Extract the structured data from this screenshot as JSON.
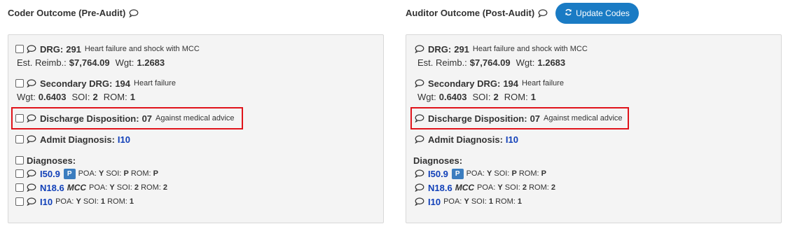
{
  "coder": {
    "title": "Coder Outcome (Pre-Audit)",
    "drg": {
      "label": "DRG:",
      "code": "291",
      "desc": "Heart failure and shock with MCC"
    },
    "reimb": {
      "label": "Est. Reimb.:",
      "value": "$7,764.09",
      "wgt_label": "Wgt:",
      "wgt": "1.2683"
    },
    "secondary": {
      "label": "Secondary DRG:",
      "code": "194",
      "desc": "Heart failure"
    },
    "sec_stats": {
      "wgt_label": "Wgt:",
      "wgt": "0.6403",
      "soi_label": "SOI:",
      "soi": "2",
      "rom_label": "ROM:",
      "rom": "1"
    },
    "discharge": {
      "label": "Discharge Disposition:",
      "code": "07",
      "desc": "Against medical advice"
    },
    "admit": {
      "label": "Admit Diagnosis:",
      "code": "I10"
    },
    "diagnoses_label": "Diagnoses:",
    "diagnoses": [
      {
        "code": "I50.9",
        "badge": "P",
        "mcc": "",
        "poa": "Y",
        "soi": "P",
        "rom": "P"
      },
      {
        "code": "N18.6",
        "badge": "",
        "mcc": "MCC",
        "poa": "Y",
        "soi": "2",
        "rom": "2"
      },
      {
        "code": "I10",
        "badge": "",
        "mcc": "",
        "poa": "Y",
        "soi": "1",
        "rom": "1"
      }
    ]
  },
  "auditor": {
    "title": "Auditor Outcome (Post-Audit)",
    "update_button": "Update Codes",
    "drg": {
      "label": "DRG:",
      "code": "291",
      "desc": "Heart failure and shock with MCC"
    },
    "reimb": {
      "label": "Est. Reimb.:",
      "value": "$7,764.09",
      "wgt_label": "Wgt:",
      "wgt": "1.2683"
    },
    "secondary": {
      "label": "Secondary DRG:",
      "code": "194",
      "desc": "Heart failure"
    },
    "sec_stats": {
      "wgt_label": "Wgt:",
      "wgt": "0.6403",
      "soi_label": "SOI:",
      "soi": "2",
      "rom_label": "ROM:",
      "rom": "1"
    },
    "discharge": {
      "label": "Discharge Disposition:",
      "code": "07",
      "desc": "Against medical advice"
    },
    "admit": {
      "label": "Admit Diagnosis:",
      "code": "I10"
    },
    "diagnoses_label": "Diagnoses:",
    "diagnoses": [
      {
        "code": "I50.9",
        "badge": "P",
        "mcc": "",
        "poa": "Y",
        "soi": "P",
        "rom": "P"
      },
      {
        "code": "N18.6",
        "badge": "",
        "mcc": "MCC",
        "poa": "Y",
        "soi": "2",
        "rom": "2"
      },
      {
        "code": "I10",
        "badge": "",
        "mcc": "",
        "poa": "Y",
        "soi": "1",
        "rom": "1"
      }
    ]
  },
  "labels": {
    "poa": "POA:",
    "soi": "SOI:",
    "rom": "ROM:"
  },
  "colors": {
    "highlight": "#e0141b",
    "link": "#1140b8",
    "button": "#1a7bc4",
    "badge": "#3b7dbf"
  }
}
